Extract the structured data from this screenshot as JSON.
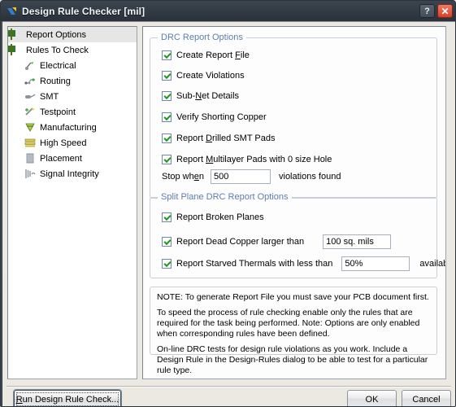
{
  "window": {
    "title": "Design Rule Checker [mil]",
    "app_icon": "altium-chevron-icon",
    "help_label": "?",
    "close_label": "✕"
  },
  "tree": {
    "items": [
      {
        "label": "Report Options",
        "icon": "folder-plus-icon",
        "level": 0,
        "selected": true
      },
      {
        "label": "Rules To Check",
        "icon": "folder-plus-icon",
        "level": 0,
        "selected": false
      },
      {
        "label": "Electrical",
        "icon": "electrical-icon",
        "level": 1,
        "selected": false
      },
      {
        "label": "Routing",
        "icon": "routing-icon",
        "level": 1,
        "selected": false
      },
      {
        "label": "SMT",
        "icon": "smt-icon",
        "level": 1,
        "selected": false
      },
      {
        "label": "Testpoint",
        "icon": "testpoint-icon",
        "level": 1,
        "selected": false
      },
      {
        "label": "Manufacturing",
        "icon": "manufacturing-icon",
        "level": 1,
        "selected": false
      },
      {
        "label": "High Speed",
        "icon": "high-speed-icon",
        "level": 1,
        "selected": false
      },
      {
        "label": "Placement",
        "icon": "placement-icon",
        "level": 1,
        "selected": false
      },
      {
        "label": "Signal Integrity",
        "icon": "signal-integrity-icon",
        "level": 1,
        "selected": false
      }
    ]
  },
  "drc_report_options": {
    "title": "DRC Report Options",
    "options": [
      {
        "label_pre": "Create Report ",
        "accel": "F",
        "label_post": "ile",
        "checked": true
      },
      {
        "label_pre": "Create Violations",
        "accel": "",
        "label_post": "",
        "checked": true
      },
      {
        "label_pre": "Sub-",
        "accel": "N",
        "label_post": "et Details",
        "checked": true
      },
      {
        "label_pre": "Verify Shorting Copper",
        "accel": "",
        "label_post": "",
        "checked": true
      },
      {
        "label_pre": "Report ",
        "accel": "D",
        "label_post": "rilled SMT Pads",
        "checked": true
      },
      {
        "label_pre": "Report ",
        "accel": "M",
        "label_post": "ultilayer Pads with 0 size Hole",
        "checked": true
      }
    ],
    "stop_when": {
      "label_pre": "Stop wh",
      "accel": "e",
      "label_post": "n",
      "value": "500",
      "suffix": "violations found"
    }
  },
  "split_plane_options": {
    "title": "Split Plane DRC Report Options",
    "broken_planes": {
      "label": "Report Broken Planes",
      "checked": true
    },
    "dead_copper": {
      "label": "Report Dead Copper larger than",
      "checked": true,
      "value": "100 sq. mils"
    },
    "starved_thermals": {
      "label": "Report Starved Thermals with less than",
      "checked": true,
      "value": "50%",
      "suffix": "available copper"
    }
  },
  "note": {
    "line1": "NOTE: To generate Report File you must save your PCB document first.",
    "line2": "To speed the process of rule checking enable only the rules that are required for the task being performed.  Note: Options are only enabled when corresponding rules have been defined.",
    "line3": "On-line DRC tests for design rule violations as you work. Include a Design Rule in the Design-Rules dialog to be able to test for a particular rule  type."
  },
  "buttons": {
    "run": {
      "accel": "R",
      "label_post": "un Design Rule Check..."
    },
    "ok": "OK",
    "cancel": "Cancel"
  },
  "colors": {
    "titlebar": "#333b45",
    "group_title": "#5b7fae",
    "check_green": "#1b9a1b",
    "close_red": "#d6402a",
    "dialog_bg": "#ece9e3"
  }
}
